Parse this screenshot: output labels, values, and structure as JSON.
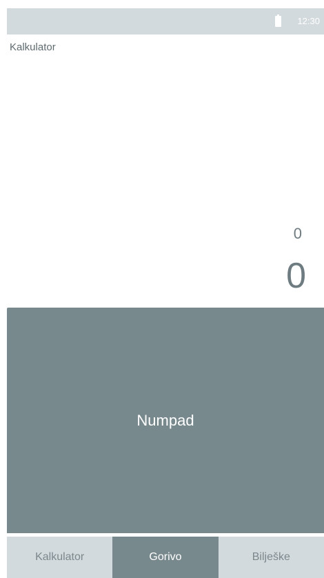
{
  "status_bar": {
    "time": "12:30",
    "battery_icon": "battery-icon"
  },
  "app": {
    "title": "Kalkulator"
  },
  "display": {
    "expression": "0",
    "result": "0"
  },
  "numpad": {
    "label": "Numpad"
  },
  "tabs": [
    {
      "label": "Kalkulator",
      "active": false
    },
    {
      "label": "Gorivo",
      "active": true
    },
    {
      "label": "Bilješke",
      "active": false
    }
  ],
  "colors": {
    "status_bar_bg": "#d3dadd",
    "accent": "#78898e",
    "text_muted": "#6e7b80"
  }
}
